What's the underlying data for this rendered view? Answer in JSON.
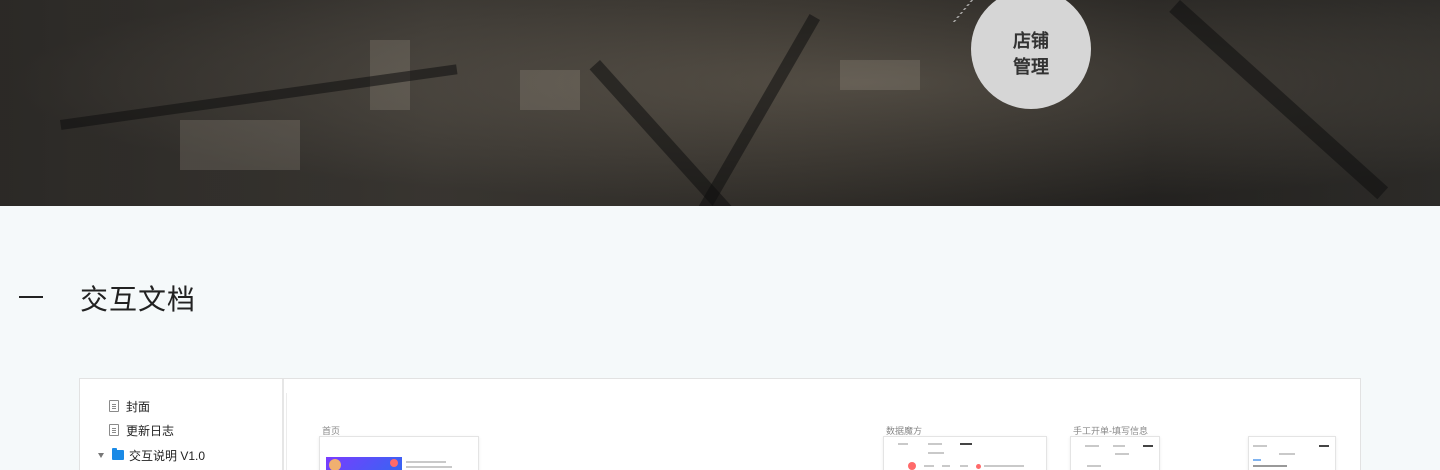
{
  "hero": {
    "circle_line1": "店铺",
    "circle_line2": "管理"
  },
  "section": {
    "title": "交互文档"
  },
  "sidebar": {
    "items": [
      {
        "label": "封面",
        "icon": "page-icon"
      },
      {
        "label": "更新日志",
        "icon": "page-icon"
      },
      {
        "label": "交互说明 V1.0",
        "icon": "folder-icon",
        "expanded": true
      }
    ]
  },
  "canvas": {
    "boards": [
      {
        "label": "首页"
      },
      {
        "label": "数据魔方"
      },
      {
        "label": "手工开单-填写信息"
      }
    ]
  },
  "colors": {
    "page_background": "#f5f9fa",
    "folder_accent": "#1a8ae6",
    "hero_circle": "#d6d6d6"
  }
}
